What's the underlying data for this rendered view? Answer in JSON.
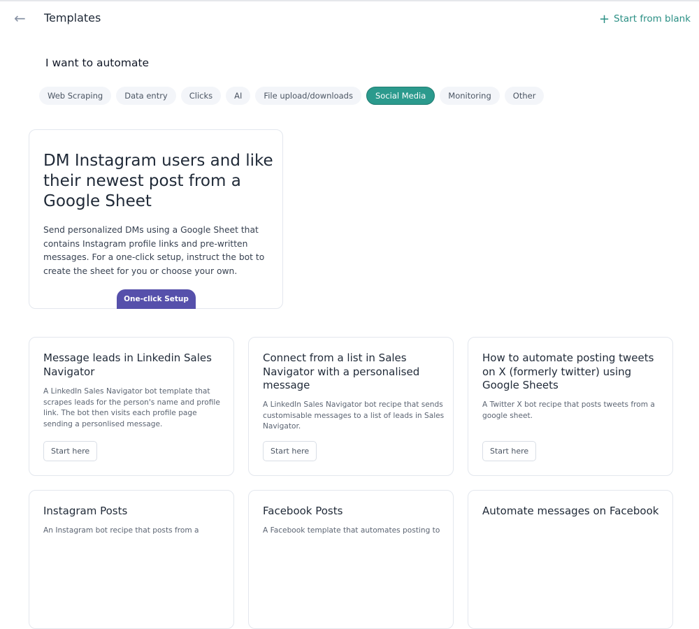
{
  "header": {
    "title": "Templates",
    "back_icon": "arrow-left-icon",
    "start_blank": "Start from blank",
    "plus_icon": "plus-icon"
  },
  "filter": {
    "heading": "I want to automate",
    "chips": [
      "Web Scraping",
      "Data entry",
      "Clicks",
      "AI",
      "File upload/downloads",
      "Social Media",
      "Monitoring",
      "Other"
    ],
    "active": "Social Media"
  },
  "featured": {
    "title": "DM Instagram users and like their newest post from a Google Sheet",
    "description": "Send personalized DMs using a Google Sheet that contains Instagram profile links and pre-written messages. For a one-click setup, instruct the bot to create the sheet for you or choose your own.",
    "button": "One-click Setup"
  },
  "cards": [
    {
      "title": "Message leads in Linkedin Sales Navigator",
      "description": "A LinkedIn Sales Navigator bot template that scrapes leads for the person's name and profile link. The bot then visits each profile page sending a personlised message.",
      "button": "Start here"
    },
    {
      "title": "Connect from a list in Sales Navigator with a personalised message",
      "description": "A LinkedIn Sales Navigator bot recipe that sends customisable messages to a list of leads in Sales Navigator.",
      "button": "Start here"
    },
    {
      "title": "How to automate posting tweets on X (formerly twitter) using Google Sheets",
      "description": "A Twitter X bot recipe that posts tweets from a google sheet.",
      "button": "Start here"
    },
    {
      "title": "Instagram Posts",
      "description": "An Instagram bot recipe that posts from a"
    },
    {
      "title": "Facebook Posts",
      "description": "A Facebook template that automates posting to"
    },
    {
      "title": "Automate messages on Facebook"
    }
  ],
  "colors": {
    "accent": "#2b9a8d",
    "setup_button": "#5650ab"
  }
}
